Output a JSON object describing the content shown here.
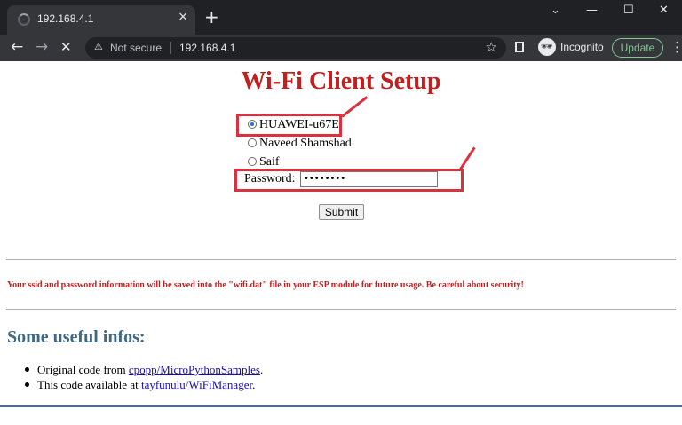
{
  "browser": {
    "tab": {
      "title": "192.168.4.1",
      "close_glyph": "×"
    },
    "new_tab_glyph": "+",
    "window_controls": {
      "minimize": "⌄",
      "restore": "—",
      "maximize": "☐",
      "close": "✕"
    },
    "nav": {
      "back": "←",
      "forward": "→",
      "stop": "✕"
    },
    "omnibox": {
      "security_icon": "warning-icon",
      "warn_glyph": "⚠",
      "security_label": "Not secure",
      "url": "192.168.4.1",
      "star_glyph": "☆"
    },
    "incognito": {
      "glyph": "🕶",
      "label": "Incognito"
    },
    "update_label": "Update",
    "menu_glyph": "⋮"
  },
  "page": {
    "title": "Wi-Fi Client Setup",
    "networks": [
      {
        "ssid": "HUAWEI-u67E",
        "selected": true
      },
      {
        "ssid": "Naveed Shamshad",
        "selected": false
      },
      {
        "ssid": "Saif",
        "selected": false
      }
    ],
    "password_label": "Password:",
    "password_value": "••••••••",
    "submit_label": "Submit",
    "notice": "Your ssid and password information will be saved into the \"wifi.dat\" file in your ESP module for future usage. Be careful about security!",
    "infos_heading": "Some useful infos:",
    "infos": [
      {
        "prefix": "Original code from ",
        "link": "cpopp/MicroPythonSamples",
        "suffix": "."
      },
      {
        "prefix": "This code available at ",
        "link": "tayfunulu/WiFiManager",
        "suffix": "."
      }
    ]
  },
  "colors": {
    "title_red": "#c21f1f",
    "heading_blue": "#3e6883",
    "highlight_red": "#d9323f",
    "link": "#1a0dab"
  }
}
